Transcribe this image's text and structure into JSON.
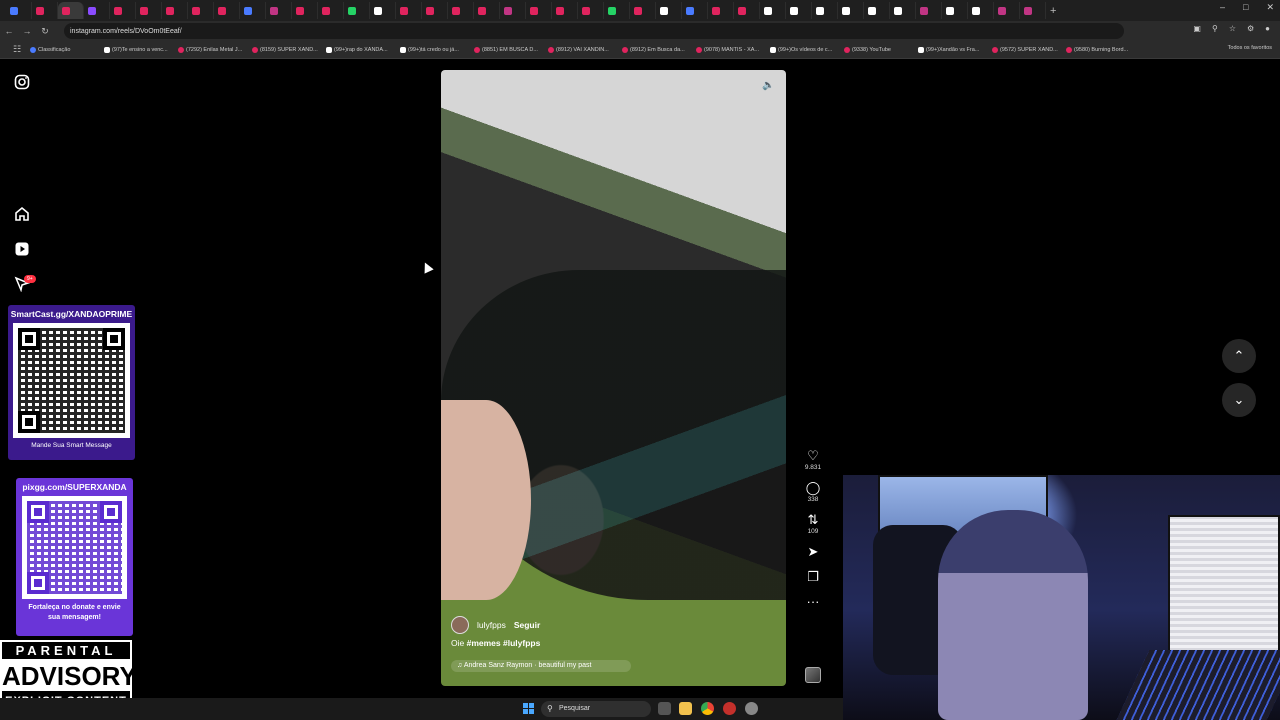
{
  "browser": {
    "url": "instagram.com/reels/DVoOm0tEeaf/",
    "bookmarks": [
      {
        "label": "Classificação",
        "kind": "g"
      },
      {
        "label": "(97)Te ensino a venc...",
        "kind": "tt"
      },
      {
        "label": "(7292) Enilas Metal J...",
        "kind": "yt"
      },
      {
        "label": "(8159) SUPER XAND...",
        "kind": "yt"
      },
      {
        "label": "(99+)rap do XANDÃ...",
        "kind": "tt"
      },
      {
        "label": "(99+)tá credo ou já...",
        "kind": "tt"
      },
      {
        "label": "(8851) EM BUSCA D...",
        "kind": "yt"
      },
      {
        "label": "(8912) VAI XANDIN...",
        "kind": "yt"
      },
      {
        "label": "(8912) Em Busca da...",
        "kind": "yt"
      },
      {
        "label": "(9078) MANTIS - XA...",
        "kind": "yt"
      },
      {
        "label": "(99+)Os vídeos de c...",
        "kind": "tt"
      },
      {
        "label": "(9338) YouTube",
        "kind": "yt"
      },
      {
        "label": "(99+)Xandão vs Fra...",
        "kind": "tt"
      },
      {
        "label": "(9572) SUPER XAND...",
        "kind": "yt"
      },
      {
        "label": "(9580) Burning Bord...",
        "kind": "yt"
      }
    ],
    "all_bookmarks": "Todos os favoritos"
  },
  "nav": {
    "notification_badge": "9+"
  },
  "overlays": {
    "qr1_title": "SmartCast.gg/XANDAOPRIME",
    "qr1_caption": "Mande Sua Smart Message",
    "qr2_title": "pixgg.com/SUPERXANDA",
    "qr2_caption": "Fortaleça no donate e envie sua mensagem!",
    "advisory_top": "PARENTAL",
    "advisory_mid": "ADVISORY",
    "advisory_bot": "EXPLICIT CONTENT"
  },
  "reel": {
    "author": "lulyfpps",
    "follow_label": "Seguir",
    "caption_prefix": "Oie",
    "caption_tags": "#memes #lulyfpps",
    "audio": "Andrea Sanz Raymon · beautiful my past",
    "likes": "9.831",
    "comments": "338",
    "reposts": "109"
  },
  "taskbar": {
    "search_placeholder": "Pesquisar"
  }
}
